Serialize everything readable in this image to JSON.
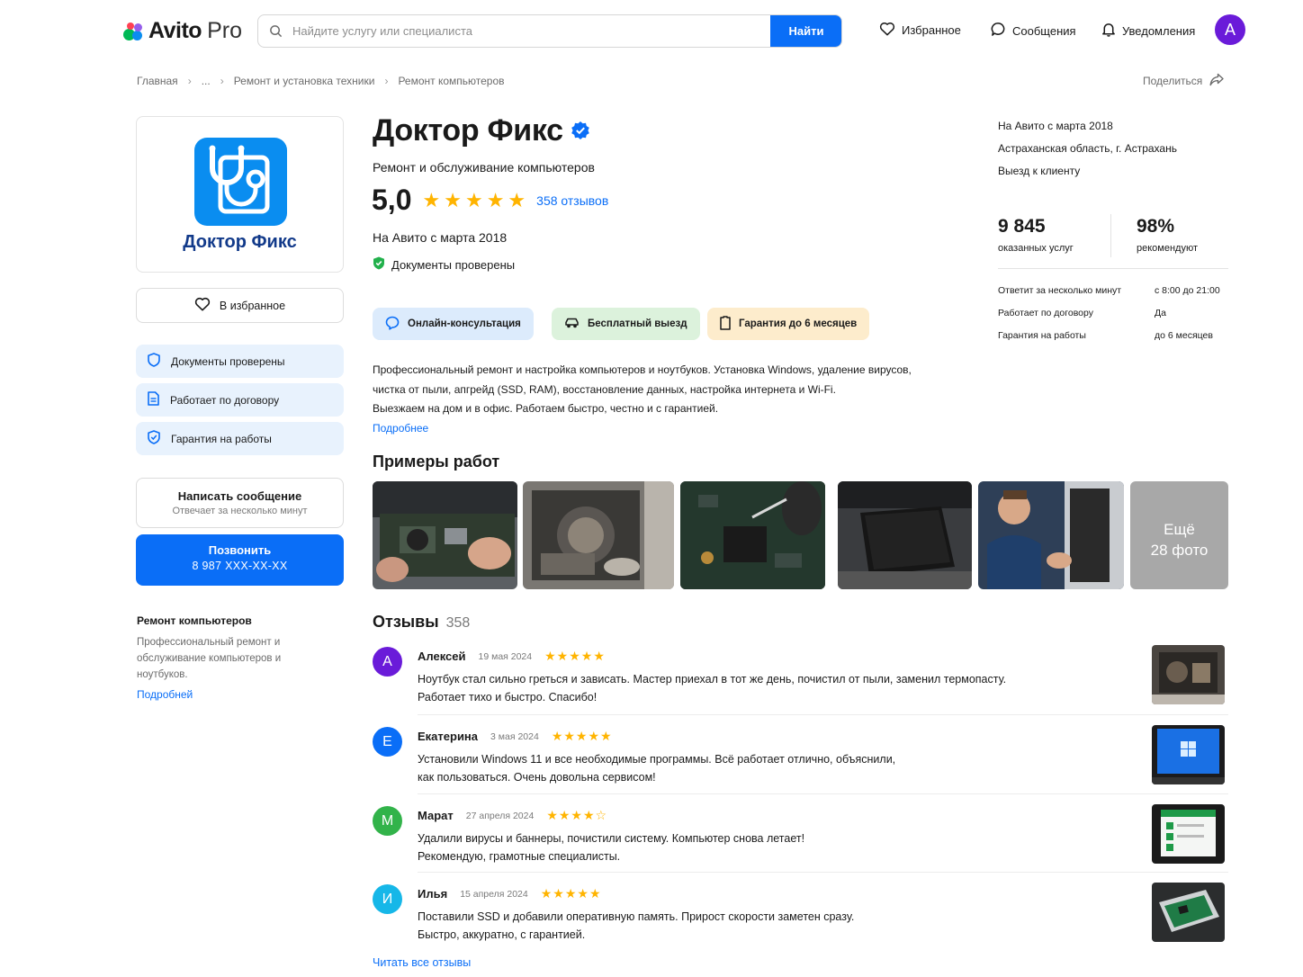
{
  "brand": {
    "name": "Avito",
    "suffix": "Pro",
    "colors": {
      "green": "#00b956",
      "blue": "#0a8df0",
      "red": "#ff4053",
      "purple": "#965eeb"
    }
  },
  "search": {
    "placeholder": "Найдите услугу или специалиста",
    "button": "Найти"
  },
  "topnav": {
    "favorites": "Избранное",
    "messages": "Сообщения",
    "notifications": "Уведомления",
    "avatar_letter": "А"
  },
  "breadcrumb": [
    "Главная",
    "...",
    "Ремонт и установка техники",
    "Ремонт компьютеров"
  ],
  "share": "Поделиться",
  "left": {
    "logo_title": "Доктор Фикс",
    "favorite_button": "В избранное",
    "features": [
      "Документы проверены",
      "Работает по договору",
      "Гарантия на работы"
    ],
    "message_button": {
      "title": "Написать сообщение",
      "subtitle": "Отвечает за несколько минут"
    },
    "call_button": {
      "title": "Позвонить",
      "phone": "8 987 XXX-XX-XX"
    },
    "category": {
      "title": "Ремонт компьютеров",
      "description": "Профессиональный ремонт и обслуживание компьютеров и ноутбуков.",
      "more": "Подробней"
    }
  },
  "profile": {
    "name": "Доктор Фикс",
    "subtitle": "Ремонт и обслуживание компьютеров",
    "rating": "5,0",
    "stars": 5,
    "reviews_link": "358 отзывов",
    "since": "На Авито с марта 2018",
    "docs_checked": "Документы проверены",
    "pills": [
      {
        "label": "Онлайн-консультация",
        "bg": "#dcebfc",
        "icon": "chat-bubble-icon"
      },
      {
        "label": "Бесплатный выезд",
        "bg": "#dcf2dc",
        "icon": "car-icon"
      },
      {
        "label": "Гарантия до 6 месяцев",
        "bg": "#fdeccc",
        "icon": "document-icon"
      }
    ],
    "description": [
      "Профессиональный ремонт и настройка компьютеров и ноутбуков. Установка Windows, удаление вирусов,",
      "чистка от пыли, апгрейд (SSD, RAM), восстановление данных, настройка интернета и Wi-Fi.",
      "Выезжаем на дом и в офис. Работаем быстро, честно и с гарантией."
    ],
    "description_more": "Подробнее"
  },
  "works": {
    "title": "Примеры работ",
    "more_label": "Ещё",
    "more_count": "28 фото"
  },
  "info": {
    "since": "На Авито с марта 2018",
    "region": "Астраханская область, г. Астрахань",
    "visit": "Выезд к клиенту",
    "stats": [
      {
        "value": "9 845",
        "label": "оказанных услуг"
      },
      {
        "value": "98%",
        "label": "рекомендуют"
      }
    ],
    "details": [
      {
        "key": "Ответит за несколько минут",
        "value": "с 8:00 до 21:00"
      },
      {
        "key": "Работает по договору",
        "value": "Да"
      },
      {
        "key": "Гарантия на работы",
        "value": "до 6 месяцев"
      }
    ]
  },
  "reviews": {
    "title": "Отзывы",
    "count": "358",
    "items": [
      {
        "letter": "А",
        "color": "#6a1bd9",
        "name": "Алексей",
        "date": "19 мая 2024",
        "stars": "★★★★★",
        "lines": [
          "Ноутбук стал сильно греться и зависать. Мастер приехал в тот же день, почистил от пыли, заменил термопасту.",
          "Работает тихо и быстро. Спасибо!"
        ]
      },
      {
        "letter": "Е",
        "color": "#0a6ef7",
        "name": "Екатерина",
        "date": "3 мая 2024",
        "stars": "★★★★★",
        "lines": [
          "Установили Windows 11 и все необходимые программы. Всё работает отлично, объяснили,",
          "как пользоваться. Очень довольна сервисом!"
        ]
      },
      {
        "letter": "М",
        "color": "#32b34a",
        "name": "Марат",
        "date": "27 апреля 2024",
        "stars": "★★★★☆",
        "lines": [
          "Удалили вирусы и баннеры, почистили систему. Компьютер снова летает!",
          "Рекомендую, грамотные специалисты."
        ]
      },
      {
        "letter": "И",
        "color": "#16b7e8",
        "name": "Илья",
        "date": "15 апреля 2024",
        "stars": "★★★★★",
        "lines": [
          "Поставили SSD и добавили оперативную память. Прирост скорости заметен сразу.",
          "Быстро, аккуратно, с гарантией."
        ]
      }
    ],
    "all_link": "Читать все отзывы"
  }
}
